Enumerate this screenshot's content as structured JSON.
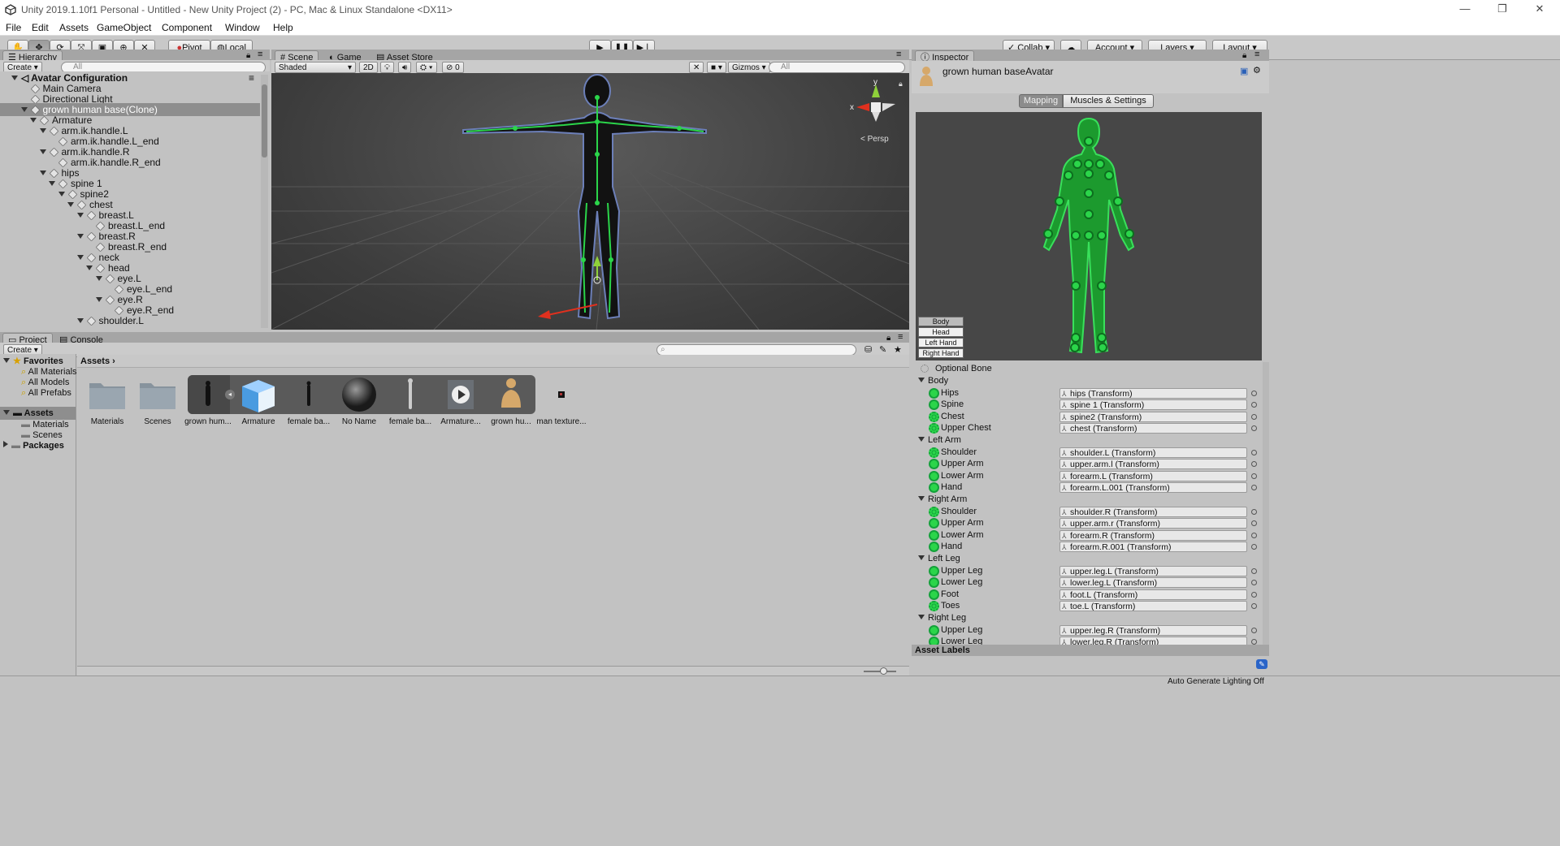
{
  "window": {
    "title": "Unity 2019.1.10f1 Personal - Untitled - New Unity Project (2) - PC, Mac & Linux Standalone <DX11>",
    "controls": [
      "—",
      "❐",
      "✕"
    ]
  },
  "menu": [
    "File",
    "Edit",
    "Assets",
    "GameObject",
    "Component",
    "Window",
    "Help"
  ],
  "toolbar": {
    "tools": [
      "hand-tool",
      "move-tool",
      "rotate-tool",
      "scale-tool",
      "rect-tool",
      "transform-tool",
      "custom-tool"
    ],
    "pivot": "Pivot",
    "local": "Local",
    "collab": "Collab",
    "account": "Account",
    "layers": "Layers",
    "layout": "Layout"
  },
  "hierarchy": {
    "tab": "Hierarchy",
    "create": "Create",
    "search_placeholder": "All",
    "scene_name": "Avatar Configuration",
    "items": [
      {
        "label": "Main Camera",
        "indent": 1,
        "arrow": ""
      },
      {
        "label": "Directional Light",
        "indent": 1,
        "arrow": ""
      },
      {
        "label": "grown human base(Clone)",
        "indent": 1,
        "arrow": "down",
        "selected": true
      },
      {
        "label": "Armature",
        "indent": 2,
        "arrow": "down"
      },
      {
        "label": "arm.ik.handle.L",
        "indent": 3,
        "arrow": "down"
      },
      {
        "label": "arm.ik.handle.L_end",
        "indent": 4,
        "arrow": ""
      },
      {
        "label": "arm.ik.handle.R",
        "indent": 3,
        "arrow": "down"
      },
      {
        "label": "arm.ik.handle.R_end",
        "indent": 4,
        "arrow": ""
      },
      {
        "label": "hips",
        "indent": 3,
        "arrow": "down"
      },
      {
        "label": "spine 1",
        "indent": 4,
        "arrow": "down"
      },
      {
        "label": "spine2",
        "indent": 5,
        "arrow": "down"
      },
      {
        "label": "chest",
        "indent": 6,
        "arrow": "down"
      },
      {
        "label": "breast.L",
        "indent": 7,
        "arrow": "down"
      },
      {
        "label": "breast.L_end",
        "indent": 8,
        "arrow": ""
      },
      {
        "label": "breast.R",
        "indent": 7,
        "arrow": "down"
      },
      {
        "label": "breast.R_end",
        "indent": 8,
        "arrow": ""
      },
      {
        "label": "neck",
        "indent": 7,
        "arrow": "down"
      },
      {
        "label": "head",
        "indent": 8,
        "arrow": "down"
      },
      {
        "label": "eye.L",
        "indent": 9,
        "arrow": "down"
      },
      {
        "label": "eye.L_end",
        "indent": 10,
        "arrow": ""
      },
      {
        "label": "eye.R",
        "indent": 9,
        "arrow": "down"
      },
      {
        "label": "eye.R_end",
        "indent": 10,
        "arrow": ""
      },
      {
        "label": "shoulder.L",
        "indent": 7,
        "arrow": "down"
      }
    ]
  },
  "scene": {
    "tabs": [
      "Scene",
      "Game",
      "Asset Store"
    ],
    "shading": "Shaded",
    "mode_2d": "2D",
    "hidden_count": "0",
    "gizmos": "Gizmos",
    "search_placeholder": "All",
    "persp": "Persp",
    "axis_y": "y",
    "axis_x": "x"
  },
  "project": {
    "tabs": [
      "Project",
      "Console"
    ],
    "create": "Create",
    "favorites": "Favorites",
    "favorite_items": [
      "All Materials",
      "All Models",
      "All Prefabs"
    ],
    "assets_root": "Assets",
    "asset_folders": [
      "Materials",
      "Scenes"
    ],
    "packages": "Packages",
    "breadcrumb": "Assets",
    "assets": [
      {
        "label": "Materials",
        "icon": "folder-icon"
      },
      {
        "label": "Scenes",
        "icon": "folder-icon"
      },
      {
        "label": "grown hum...",
        "icon": "model-icon"
      },
      {
        "label": "Armature",
        "icon": "cube-icon"
      },
      {
        "label": "female ba...",
        "icon": "figure-icon"
      },
      {
        "label": "No Name",
        "icon": "sphere-icon"
      },
      {
        "label": "female ba...",
        "icon": "figure-icon"
      },
      {
        "label": "Armature...",
        "icon": "play-icon"
      },
      {
        "label": "grown hu...",
        "icon": "avatar-icon"
      },
      {
        "label": "man texture...",
        "icon": "texture-icon"
      }
    ]
  },
  "inspector": {
    "tab": "Inspector",
    "object_name": "grown human baseAvatar",
    "tabs": [
      "Mapping",
      "Muscles & Settings"
    ],
    "view_buttons": [
      "Body",
      "Head",
      "Left Hand",
      "Right Hand"
    ],
    "optional_bone": "Optional Bone",
    "groups": [
      {
        "name": "Body",
        "bones": [
          {
            "label": "Hips",
            "value": "hips (Transform)",
            "optional": false
          },
          {
            "label": "Spine",
            "value": "spine 1 (Transform)",
            "optional": false
          },
          {
            "label": "Chest",
            "value": "spine2 (Transform)",
            "optional": true
          },
          {
            "label": "Upper Chest",
            "value": "chest (Transform)",
            "optional": true
          }
        ]
      },
      {
        "name": "Left Arm",
        "bones": [
          {
            "label": "Shoulder",
            "value": "shoulder.L (Transform)",
            "optional": true
          },
          {
            "label": "Upper Arm",
            "value": "upper.arm.l (Transform)",
            "optional": false
          },
          {
            "label": "Lower Arm",
            "value": "forearm.L (Transform)",
            "optional": false
          },
          {
            "label": "Hand",
            "value": "forearm.L.001 (Transform)",
            "optional": false
          }
        ]
      },
      {
        "name": "Right Arm",
        "bones": [
          {
            "label": "Shoulder",
            "value": "shoulder.R (Transform)",
            "optional": true
          },
          {
            "label": "Upper Arm",
            "value": "upper.arm.r (Transform)",
            "optional": false
          },
          {
            "label": "Lower Arm",
            "value": "forearm.R (Transform)",
            "optional": false
          },
          {
            "label": "Hand",
            "value": "forearm.R.001 (Transform)",
            "optional": false
          }
        ]
      },
      {
        "name": "Left Leg",
        "bones": [
          {
            "label": "Upper Leg",
            "value": "upper.leg.L (Transform)",
            "optional": false
          },
          {
            "label": "Lower Leg",
            "value": "lower.leg.L (Transform)",
            "optional": false
          },
          {
            "label": "Foot",
            "value": "foot.L (Transform)",
            "optional": false
          },
          {
            "label": "Toes",
            "value": "toe.L (Transform)",
            "optional": true
          }
        ]
      },
      {
        "name": "Right Leg",
        "bones": [
          {
            "label": "Upper Leg",
            "value": "upper.leg.R (Transform)",
            "optional": false
          },
          {
            "label": "Lower Leg",
            "value": "lower.leg.R (Transform)",
            "optional": false
          }
        ]
      }
    ],
    "asset_labels": "Asset Labels"
  },
  "status": {
    "lighting": "Auto Generate Lighting Off"
  },
  "colors": {
    "bone_green": "#2bd54a",
    "selection": "#8e8e8e",
    "scene_bg": "#3c3c3c",
    "x_axis": "#e0301e",
    "y_axis": "#8fd13a"
  }
}
